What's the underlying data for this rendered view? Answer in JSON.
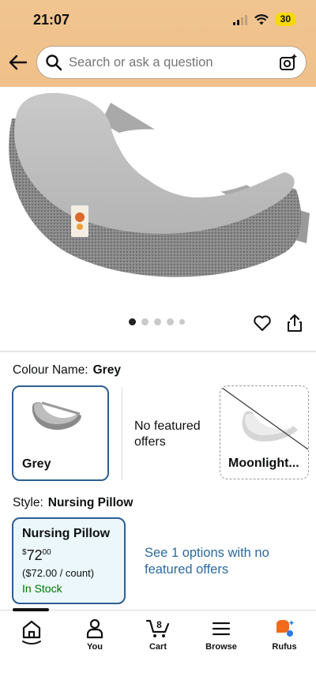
{
  "status": {
    "time": "21:07",
    "battery": "30"
  },
  "search": {
    "placeholder": "Search or ask a question"
  },
  "colour": {
    "label": "Colour Name:",
    "value": "Grey",
    "swatches": [
      {
        "name": "Grey"
      },
      {
        "name": "Moonlight..."
      }
    ],
    "no_offers": "No featured offers"
  },
  "style": {
    "label": "Style:",
    "value": "Nursing Pillow",
    "card": {
      "title": "Nursing Pillow",
      "price_main": "72",
      "price_currency": "$",
      "price_fraction": "00",
      "unit_price": "($72.00 / count)",
      "stock": "In Stock"
    },
    "see_options": "See 1 options with no featured offers"
  },
  "carousel": {
    "count": 5,
    "active": 0
  },
  "tabbar": {
    "items": [
      {
        "label": "",
        "icon": "home-icon"
      },
      {
        "label": "You",
        "icon": "person-icon"
      },
      {
        "label": "Cart",
        "icon": "cart-icon",
        "badge": "8"
      },
      {
        "label": "Browse",
        "icon": "menu-icon"
      },
      {
        "label": "Rufus",
        "icon": "rufus-icon"
      }
    ]
  },
  "colors": {
    "header": "#efc08a",
    "selected_border": "#2d5e94",
    "link": "#2a6aa0",
    "in_stock": "#007600",
    "card_bg": "#ebf7fb"
  }
}
